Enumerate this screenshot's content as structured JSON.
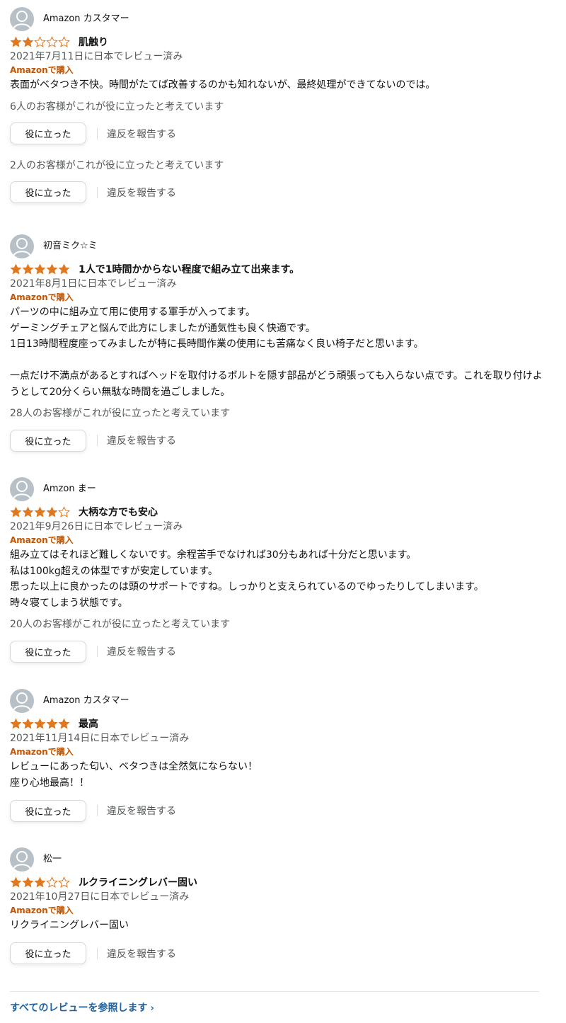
{
  "colors": {
    "star": "#de7921",
    "star_empty": "#de7921",
    "verified": "#c45500",
    "link": "#2162a1"
  },
  "icons": {
    "avatar": "user-avatar-icon",
    "star": "star-icon",
    "chevron": "chevron-right-icon"
  },
  "reviews": [
    {
      "username": "Amazon カスタマー",
      "rating": 2,
      "title": "肌触り",
      "date": "2021年7月11日に日本でレビュー済み",
      "verified": "Amazonで購入",
      "body": "表面がベタつき不快。時間がたてば改善するのかも知れないが、最終処理ができてないのでは。",
      "helpful_count": "6人のお客様がこれが役に立ったと考えています",
      "helpful_button": "役に立った",
      "report_link": "違反を報告する",
      "helpful_count_2": "2人のお客様がこれが役に立ったと考えています",
      "helpful_button_2": "役に立った",
      "report_link_2": "違反を報告する"
    },
    {
      "username": "初音ミク☆ミ",
      "rating": 5,
      "title": "1人で1時間かからない程度で組み立て出来ます。",
      "date": "2021年8月1日に日本でレビュー済み",
      "verified": "Amazonで購入",
      "body": "パーツの中に組み立て用に使用する軍手が入ってます。\nゲーミングチェアと悩んで此方にしましたが通気性も良く快適です。\n1日13時間程度座ってみましたが特に長時間作業の使用にも苦痛なく良い椅子だと思います。\n\n一点だけ不満点があるとすればヘッドを取付けるボルトを隠す部品がどう頑張っても入らない点です。これを取り付けようとして20分くらい無駄な時間を過ごしました。",
      "helpful_count": "28人のお客様がこれが役に立ったと考えています",
      "helpful_button": "役に立った",
      "report_link": "違反を報告する"
    },
    {
      "username": "Amzon まー",
      "rating": 4,
      "title": "大柄な方でも安心",
      "date": "2021年9月26日に日本でレビュー済み",
      "verified": "Amazonで購入",
      "body": "組み立てはそれほど難しくないです。余程苦手でなければ30分もあれば十分だと思います。\n私は100kg超えの体型ですが安定しています。\n思った以上に良かったのは頭のサポートですね。しっかりと支えられているのでゆったりしてしまいます。\n時々寝てしまう状態です。",
      "helpful_count": "20人のお客様がこれが役に立ったと考えています",
      "helpful_button": "役に立った",
      "report_link": "違反を報告する"
    },
    {
      "username": "Amazon カスタマー",
      "rating": 5,
      "title": "最高",
      "date": "2021年11月14日に日本でレビュー済み",
      "verified": "Amazonで購入",
      "body": "レビューにあった匂い、ベタつきは全然気にならない！\n座り心地最高！！",
      "helpful_button": "役に立った",
      "report_link": "違反を報告する"
    },
    {
      "username": "松一",
      "rating": 3,
      "title": "ルクライニングレバー固い",
      "date": "2021年10月27日に日本でレビュー済み",
      "verified": "Amazonで購入",
      "body": "リクライニングレバー固い",
      "helpful_button": "役に立った",
      "report_link": "違反を報告する"
    }
  ],
  "footer": {
    "see_all": "すべてのレビューを参照します",
    "chevron": "›"
  }
}
